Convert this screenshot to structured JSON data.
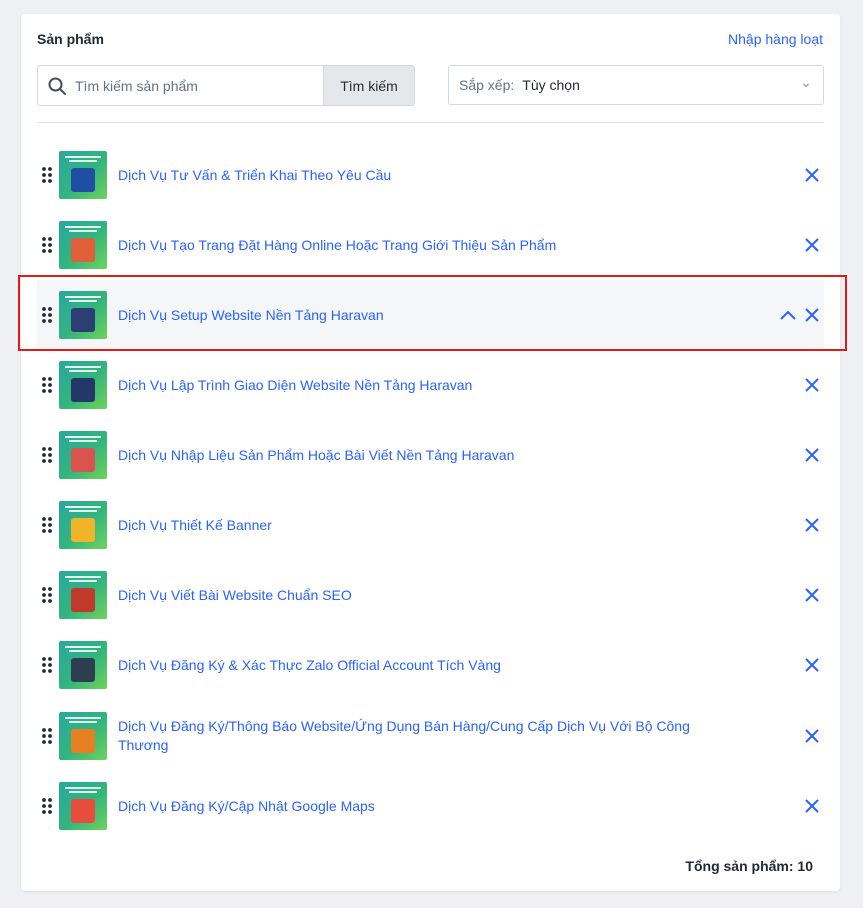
{
  "header": {
    "title": "Sản phẩm",
    "bulk_import_label": "Nhập hàng loạt"
  },
  "search": {
    "placeholder": "Tìm kiếm sản phẩm",
    "value": "",
    "button_label": "Tìm kiếm"
  },
  "sort": {
    "label": "Sắp xếp:",
    "value": "Tùy chọn"
  },
  "products": [
    {
      "name": "Dịch Vụ Tư Vấn & Triển Khai Theo Yêu Cầu",
      "figure_color": "#1f4fa3"
    },
    {
      "name": "Dịch Vụ Tạo Trang Đặt Hàng Online Hoặc Trang Giới Thiệu Sản Phẩm",
      "figure_color": "#e0603a"
    },
    {
      "name": "Dịch Vụ Setup Website Nền Tảng Haravan",
      "figure_color": "#2b3f74"
    },
    {
      "name": "Dịch Vụ Lập Trình Giao Diện Website Nền Tảng Haravan",
      "figure_color": "#233866"
    },
    {
      "name": "Dịch Vụ Nhập Liệu Sản Phẩm Hoặc Bài Viết Nền Tảng Haravan",
      "figure_color": "#d9534f"
    },
    {
      "name": "Dịch Vụ Thiết Kế Banner",
      "figure_color": "#f0b429"
    },
    {
      "name": "Dịch Vụ Viết Bài Website Chuẩn SEO",
      "figure_color": "#c0392b"
    },
    {
      "name": "Dịch Vụ Đăng Ký & Xác Thực Zalo Official Account Tích Vàng",
      "figure_color": "#2c3e50"
    },
    {
      "name": "Dịch Vụ Đăng Ký/Thông Báo Website/Ứng Dụng Bán Hàng/Cung Cấp Dịch Vụ Với Bộ Công Thương",
      "figure_color": "#e67e22"
    },
    {
      "name": "Dịch Vụ Đăng Ký/Cập Nhật Google Maps",
      "figure_color": "#e74c3c"
    }
  ],
  "footer": {
    "total_label": "Tổng sản phẩm: 10"
  },
  "colors": {
    "accent": "#2962ff",
    "highlight": "#e01b1b"
  },
  "icons": {
    "search": "search-icon",
    "sort_caret": "chevron-down-icon",
    "drag": "drag-handle-icon",
    "collapse": "chevron-up-icon",
    "remove": "close-icon"
  }
}
